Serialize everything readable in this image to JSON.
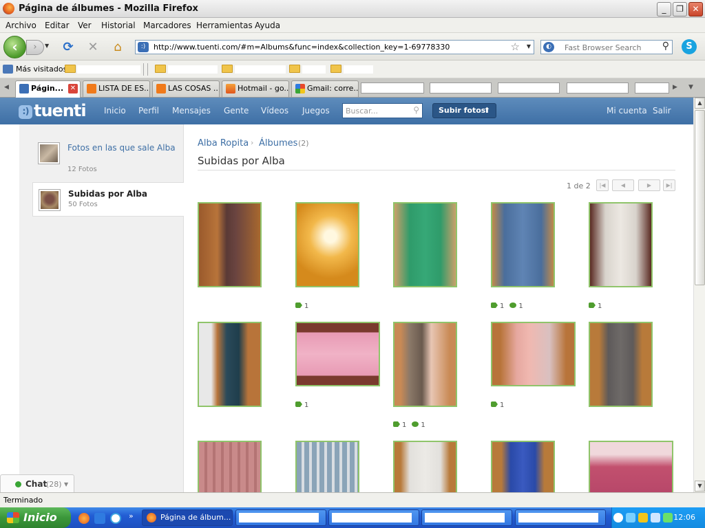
{
  "window": {
    "title": "Página de álbumes - Mozilla Firefox",
    "minimize": "_",
    "maximize": "❐",
    "close": "✕"
  },
  "menu": [
    "Archivo",
    "Editar",
    "Ver",
    "Historial",
    "Marcadores",
    "Herramientas",
    "Ayuda"
  ],
  "nav": {
    "back": "‹",
    "forward": "›",
    "reload": "⟳",
    "stop": "✕",
    "home": "⌂",
    "url": "http://www.tuenti.com/#m=Albums&func=index&collection_key=1-69778330",
    "search_placeholder": "Fast Browser Search",
    "skype": "S"
  },
  "bookmarks": {
    "most_visited": "Más visitados"
  },
  "tabs": [
    {
      "label": "Págin...",
      "active": true
    },
    {
      "label": "LISTA DE ES..."
    },
    {
      "label": "LAS COSAS ..."
    },
    {
      "label": "Hotmail - go..."
    },
    {
      "label": "Gmail: corre..."
    }
  ],
  "tuenti": {
    "logo": "tuenti",
    "logo_glyph": ":)",
    "nav": [
      "Inicio",
      "Perfil",
      "Mensajes",
      "Gente",
      "Vídeos",
      "Juegos"
    ],
    "search_placeholder": "Buscar...",
    "upload_label": "Subir fotos",
    "account": "Mi cuenta",
    "logout": "Salir"
  },
  "sidebar": {
    "items": [
      {
        "title": "Fotos en las que sale Alba",
        "count": "12 Fotos",
        "active": false
      },
      {
        "title": "Subidas por Alba",
        "count": "50 Fotos",
        "active": true
      }
    ]
  },
  "chat": {
    "label": "Chat",
    "count": "(28)"
  },
  "content": {
    "breadcrumb_user": "Alba Ropita",
    "breadcrumb_albums": "Álbumes",
    "breadcrumb_count": "(2)",
    "title": "Subidas por Alba",
    "pager": "1 de 2"
  },
  "photos": [
    {
      "desc": "swimsuit",
      "tags": null,
      "comments": null
    },
    {
      "desc": "necklace",
      "tags": "1",
      "comments": null
    },
    {
      "desc": "green dress",
      "tags": null,
      "comments": null
    },
    {
      "desc": "denim jacket",
      "tags": "1",
      "comments": "1"
    },
    {
      "desc": "tank top",
      "tags": "1",
      "comments": null
    },
    {
      "desc": "jumpsuit",
      "tags": null,
      "comments": null
    },
    {
      "desc": "jewelry box",
      "tags": "1",
      "comments": null
    },
    {
      "desc": "phone",
      "tags": "1",
      "comments": "1"
    },
    {
      "desc": "phone case",
      "tags": "1",
      "comments": null
    },
    {
      "desc": "grey dress",
      "tags": null,
      "comments": null
    },
    {
      "desc": "plaid shorts",
      "tags": null,
      "comments": null
    },
    {
      "desc": "check shorts",
      "tags": null,
      "comments": null
    },
    {
      "desc": "white top",
      "tags": null,
      "comments": null
    },
    {
      "desc": "blue tank",
      "tags": null,
      "comments": null
    },
    {
      "desc": "pink shorts",
      "tags": null,
      "comments": null
    }
  ],
  "status": "Terminado",
  "taskbar": {
    "start": "Inicio",
    "active_task": "Página de álbum...",
    "clock": "12:06"
  },
  "colors": {
    "tuenti_blue": "#4a7db4",
    "photo_border": "#8fc46a",
    "link": "#3e6fa5"
  }
}
